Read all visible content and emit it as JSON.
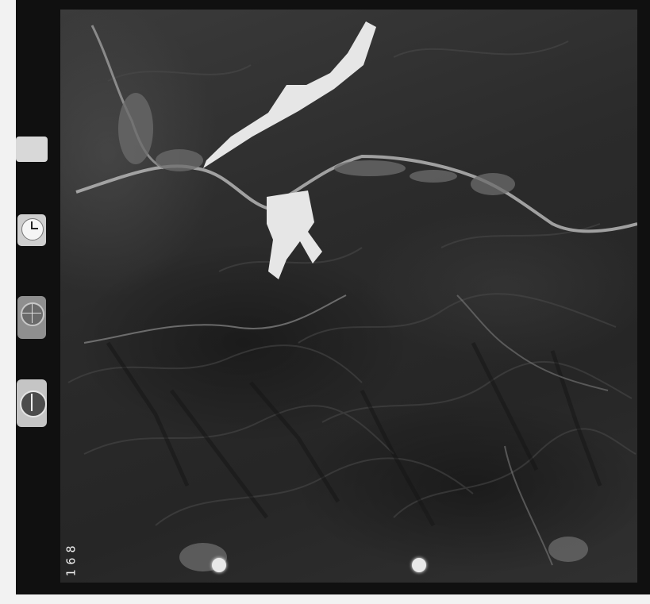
{
  "photo": {
    "frame_number": "168",
    "data_label": "",
    "icons": {
      "clock": "clock-icon",
      "altimeter": "altimeter-icon",
      "compass": "compass-icon"
    }
  },
  "colors": {
    "film_border": "#101010",
    "terrain_dark": "#262626",
    "terrain_light": "#4a4a4a",
    "river": "#b5b5b5",
    "masked_area": "#e6e6e6",
    "page_background": "#f2f2f2"
  }
}
